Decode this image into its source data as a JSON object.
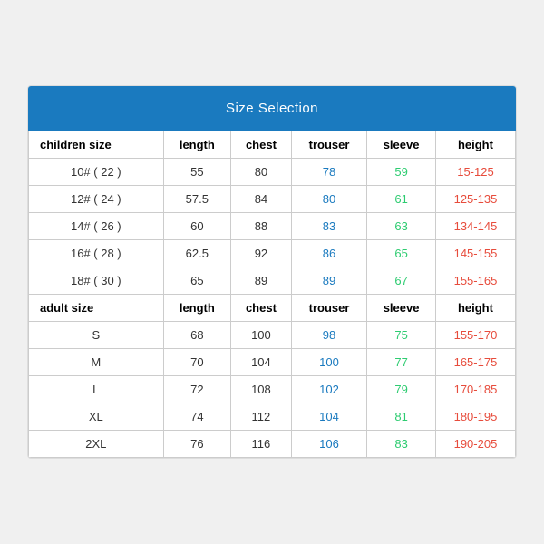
{
  "title": "Size Selection",
  "columns": [
    "children size",
    "length",
    "chest",
    "trouser",
    "sleeve",
    "height"
  ],
  "adult_columns": [
    "adult size",
    "length",
    "chest",
    "trouser",
    "sleeve",
    "height"
  ],
  "children_rows": [
    {
      "size": "10# ( 22 )",
      "length": "55",
      "chest": "80",
      "trouser": "78",
      "sleeve": "59",
      "height": "15-125"
    },
    {
      "size": "12# ( 24 )",
      "length": "57.5",
      "chest": "84",
      "trouser": "80",
      "sleeve": "61",
      "height": "125-135"
    },
    {
      "size": "14# ( 26 )",
      "length": "60",
      "chest": "88",
      "trouser": "83",
      "sleeve": "63",
      "height": "134-145"
    },
    {
      "size": "16# ( 28 )",
      "length": "62.5",
      "chest": "92",
      "trouser": "86",
      "sleeve": "65",
      "height": "145-155"
    },
    {
      "size": "18# ( 30 )",
      "length": "65",
      "chest": "89",
      "trouser": "89",
      "sleeve": "67",
      "height": "155-165"
    }
  ],
  "adult_rows": [
    {
      "size": "S",
      "length": "68",
      "chest": "100",
      "trouser": "98",
      "sleeve": "75",
      "height": "155-170"
    },
    {
      "size": "M",
      "length": "70",
      "chest": "104",
      "trouser": "100",
      "sleeve": "77",
      "height": "165-175"
    },
    {
      "size": "L",
      "length": "72",
      "chest": "108",
      "trouser": "102",
      "sleeve": "79",
      "height": "170-185"
    },
    {
      "size": "XL",
      "length": "74",
      "chest": "112",
      "trouser": "104",
      "sleeve": "81",
      "height": "180-195"
    },
    {
      "size": "2XL",
      "length": "76",
      "chest": "116",
      "trouser": "106",
      "sleeve": "83",
      "height": "190-205"
    }
  ]
}
